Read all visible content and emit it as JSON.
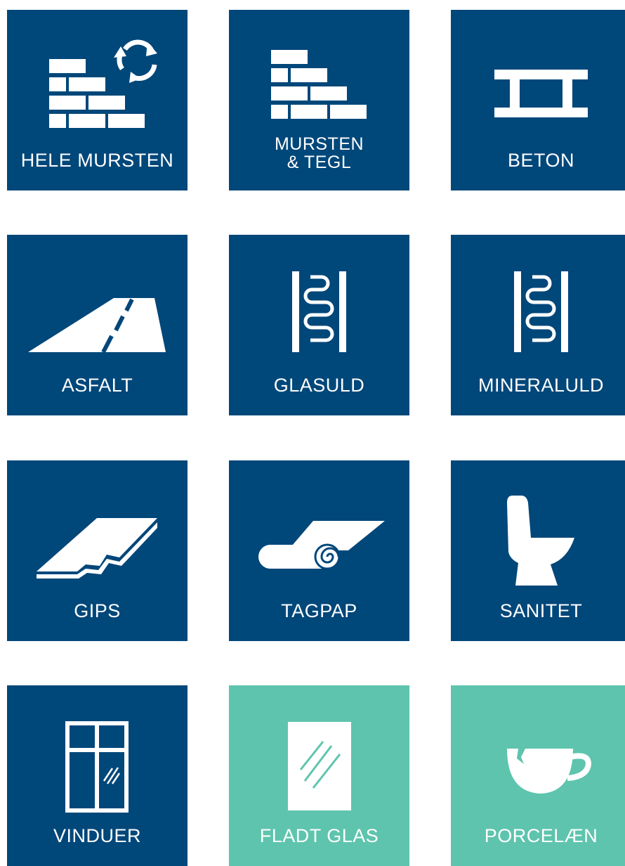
{
  "colors": {
    "primary_tile": "#00477a",
    "secondary_tile": "#5ec4ad",
    "icon": "#ffffff"
  },
  "tiles": [
    {
      "label": "HELE MURSTEN",
      "icon": "bricks-recycle-icon"
    },
    {
      "label_line1": "MURSTEN",
      "label_line2": "& TEGL",
      "icon": "bricks-icon"
    },
    {
      "label": "BETON",
      "icon": "beam-icon"
    },
    {
      "label": "ASFALT",
      "icon": "road-icon"
    },
    {
      "label": "GLASULD",
      "icon": "insulation-icon"
    },
    {
      "label": "MINERALULD",
      "icon": "insulation-icon"
    },
    {
      "label": "GIPS",
      "icon": "plasterboard-icon"
    },
    {
      "label": "TAGPAP",
      "icon": "roofing-roll-icon"
    },
    {
      "label": "SANITET",
      "icon": "toilet-icon"
    },
    {
      "label": "VINDUER",
      "icon": "window-icon"
    },
    {
      "label": "FLADT GLAS",
      "icon": "flat-glass-icon"
    },
    {
      "label": "PORCELÆN",
      "icon": "broken-cup-icon"
    }
  ]
}
